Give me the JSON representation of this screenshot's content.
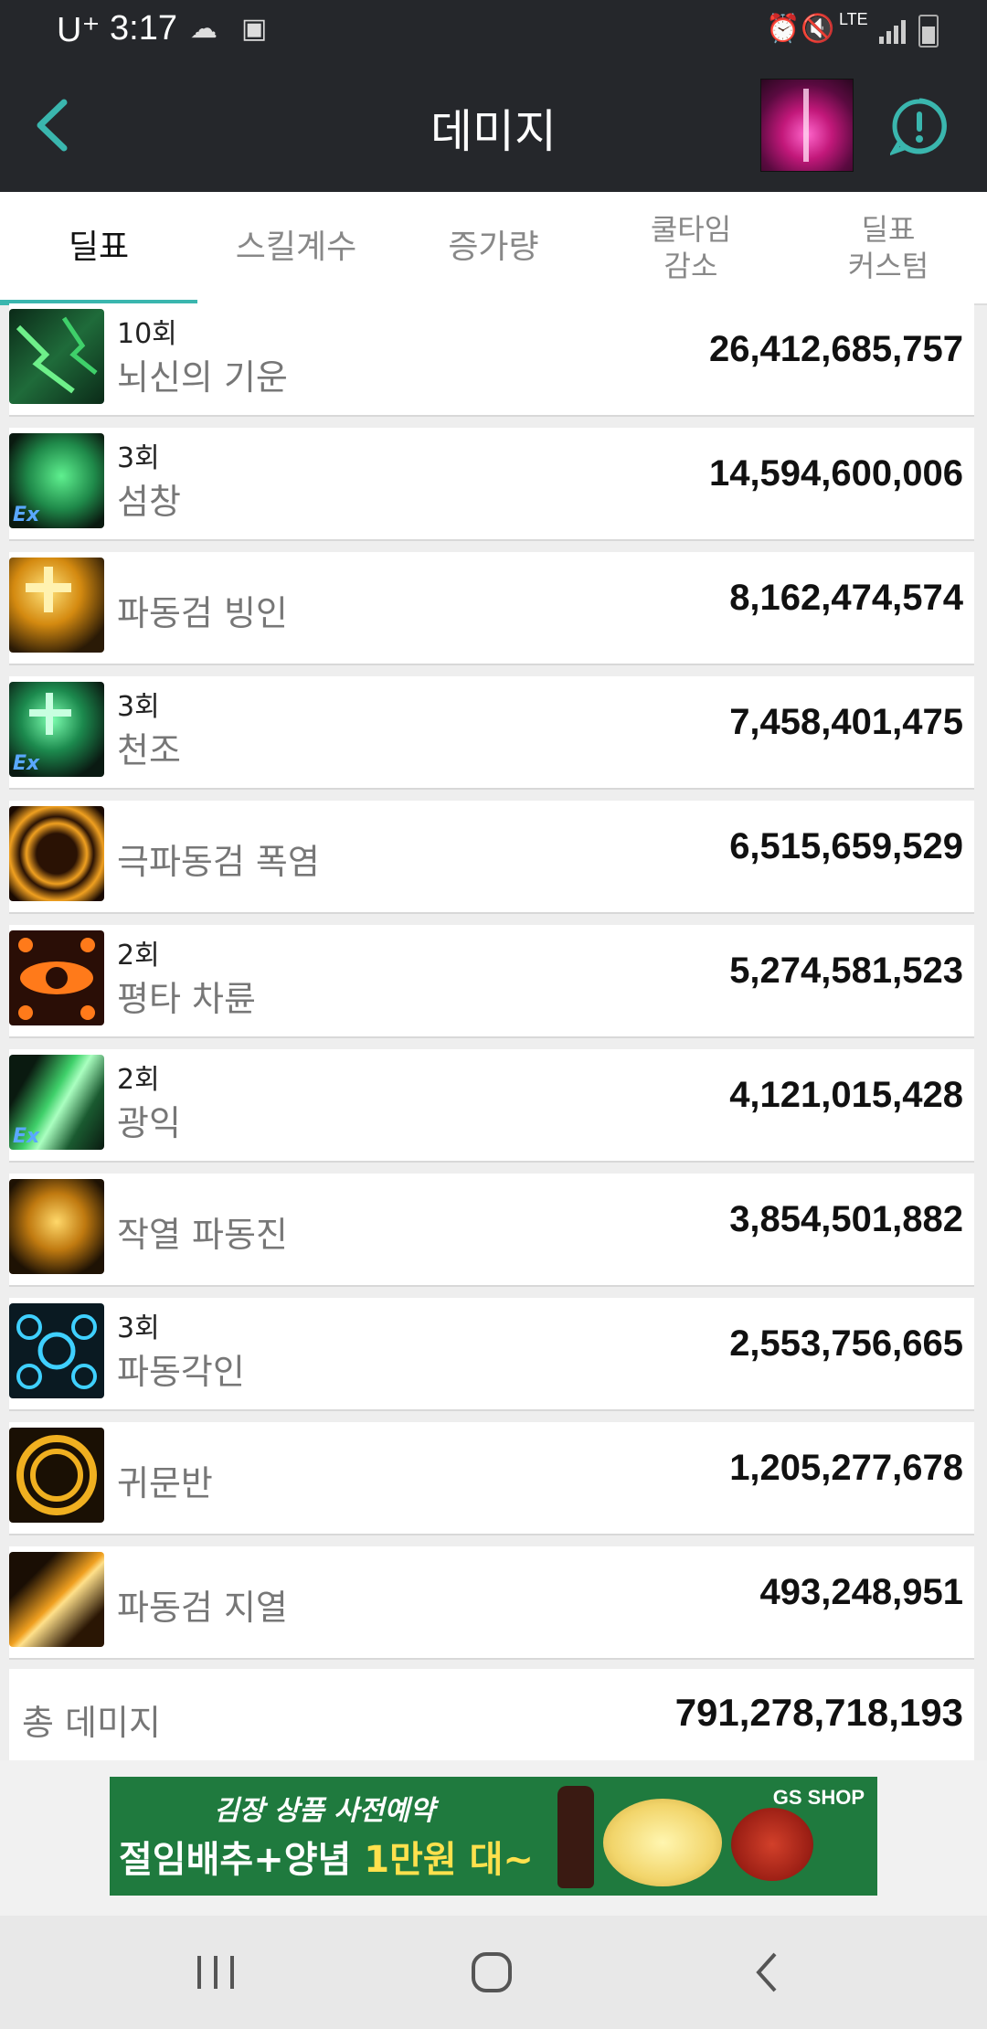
{
  "status_bar": {
    "carrier": "U⁺",
    "time": "3:17",
    "network": "LTE"
  },
  "header": {
    "title": "데미지"
  },
  "tabs": [
    {
      "label": "딜표",
      "active": true
    },
    {
      "label": "스킬계수",
      "active": false
    },
    {
      "label": "증가량",
      "active": false
    },
    {
      "label": "쿨타임\n감소",
      "active": false
    },
    {
      "label": "딜표\n커스텀",
      "active": false
    }
  ],
  "skills": [
    {
      "count": "10회",
      "name": "뇌신의 기운",
      "damage": "26,412,685,757",
      "icon": "lightning-skill-icon",
      "ex": false
    },
    {
      "count": "3회",
      "name": "섬창",
      "damage": "14,594,600,006",
      "icon": "green-flame-skill-icon",
      "ex": true
    },
    {
      "count": "",
      "name": "파동검 빙인",
      "damage": "8,162,474,574",
      "icon": "golden-cross-skill-icon",
      "ex": false
    },
    {
      "count": "3회",
      "name": "천조",
      "damage": "7,458,401,475",
      "icon": "green-cross-skill-icon",
      "ex": true
    },
    {
      "count": "",
      "name": "극파동검 폭염",
      "damage": "6,515,659,529",
      "icon": "fire-orb-skill-icon",
      "ex": false
    },
    {
      "count": "2회",
      "name": "평타 차륜",
      "damage": "5,274,581,523",
      "icon": "eye-skill-icon",
      "ex": false
    },
    {
      "count": "2회",
      "name": "광익",
      "damage": "4,121,015,428",
      "icon": "green-wing-skill-icon",
      "ex": true
    },
    {
      "count": "",
      "name": "작열 파동진",
      "damage": "3,854,501,882",
      "icon": "golden-figure-skill-icon",
      "ex": false
    },
    {
      "count": "3회",
      "name": "파동각인",
      "damage": "2,553,756,665",
      "icon": "blue-rune-skill-icon",
      "ex": false
    },
    {
      "count": "",
      "name": "귀문반",
      "damage": "1,205,277,678",
      "icon": "golden-seal-skill-icon",
      "ex": false
    },
    {
      "count": "",
      "name": "파동검 지열",
      "damage": "493,248,951",
      "icon": "golden-slash-skill-icon",
      "ex": false
    }
  ],
  "total": {
    "label": "총 데미지",
    "value": "791,278,718,193"
  },
  "ad": {
    "subtitle": "김장 상품 사전예약",
    "main_prefix": "절임배추+양념 ",
    "main_highlight": "1만원 대~",
    "brand": "GS SHOP"
  },
  "ex_badge": "Ex",
  "colors": {
    "accent": "#3ab6ae",
    "header_bg": "#25272b",
    "ad_bg": "#1f7a3e"
  }
}
